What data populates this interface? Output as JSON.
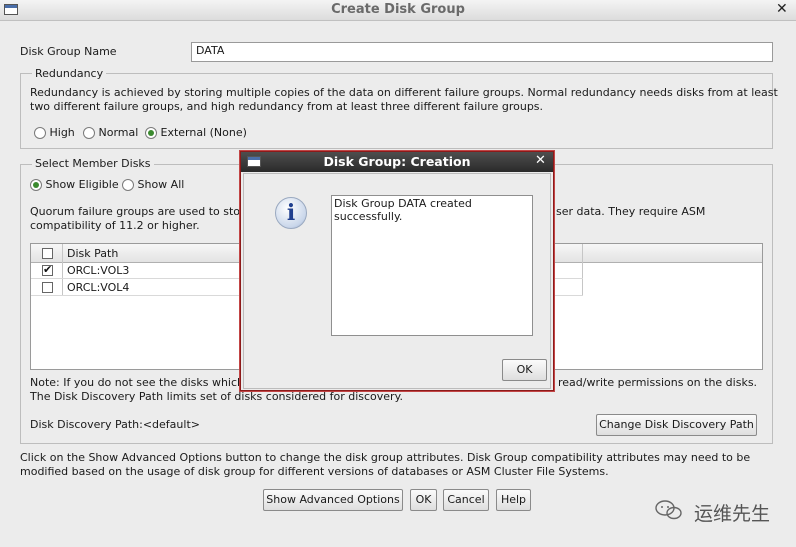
{
  "window": {
    "title": "Create Disk Group",
    "close_glyph": "✕"
  },
  "dg_name": {
    "label": "Disk Group Name",
    "value": "DATA"
  },
  "redundancy": {
    "legend": "Redundancy",
    "desc1": "Redundancy is achieved by storing multiple copies of the data on different failure groups. Normal redundancy needs disks from at least",
    "desc2": "two different failure groups, and high redundancy from at least three different failure groups.",
    "options": [
      {
        "label": "High",
        "selected": false
      },
      {
        "label": "Normal",
        "selected": false
      },
      {
        "label": "External (None)",
        "selected": true
      }
    ]
  },
  "member": {
    "legend": "Select Member Disks",
    "show_eligible": "Show Eligible",
    "show_all": "Show All",
    "quorum1_left": "Quorum failure groups are used to stor",
    "quorum1_right": "ser data. They require ASM",
    "quorum2": "compatibility of 11.2 or higher.",
    "table": {
      "header": "Disk Path",
      "rows": [
        {
          "path": "ORCL:VOL3",
          "checked": true
        },
        {
          "path": "ORCL:VOL4",
          "checked": false
        }
      ]
    },
    "note1_left": "Note: If you do not see the disks which",
    "note1_right": "read/write permissions on the disks.",
    "note2": "The Disk Discovery Path limits set of disks considered for discovery.",
    "discovery_path": "Disk Discovery Path:<default>",
    "change_path_button": "Change Disk Discovery Path"
  },
  "bottom": {
    "info1": "Click on the Show Advanced Options button to change the disk group attributes. Disk Group compatibility attributes may need to be",
    "info2": "modified based on the usage of disk group for different versions of databases or ASM Cluster File Systems.",
    "buttons": {
      "advanced": "Show Advanced Options",
      "ok": "OK",
      "cancel": "Cancel",
      "help": "Help"
    }
  },
  "dialog": {
    "title": "Disk Group: Creation",
    "close_glyph": "✕",
    "message_line1": "Disk Group DATA created",
    "message_line2": "successfully.",
    "ok": "OK",
    "icon": "info-icon"
  },
  "watermark": {
    "text": "运维先生"
  }
}
